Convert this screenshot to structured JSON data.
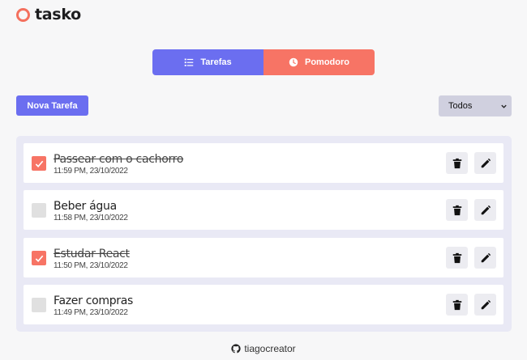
{
  "app": {
    "name": "tasko"
  },
  "tabs": [
    {
      "label": "Tarefas",
      "icon": "list-check-icon",
      "color": "#6b6ef0"
    },
    {
      "label": "Pomodoro",
      "icon": "clock-icon",
      "color": "#f77465"
    }
  ],
  "toolbar": {
    "new_task_label": "Nova Tarefa",
    "filter_selected": "Todos"
  },
  "tasks": [
    {
      "title": "Passear com o cachorro",
      "date": "11:59 PM, 23/10/2022",
      "done": true
    },
    {
      "title": "Beber água",
      "date": "11:58 PM, 23/10/2022",
      "done": false
    },
    {
      "title": "Estudar React",
      "date": "11:50 PM, 23/10/2022",
      "done": true
    },
    {
      "title": "Fazer compras",
      "date": "11:49 PM, 23/10/2022",
      "done": false
    }
  ],
  "footer": {
    "author": "tiagocreator",
    "icon": "github-icon"
  },
  "colors": {
    "primary": "#6b6ef0",
    "accent": "#f77465",
    "list_bg": "#e9e9f5"
  }
}
